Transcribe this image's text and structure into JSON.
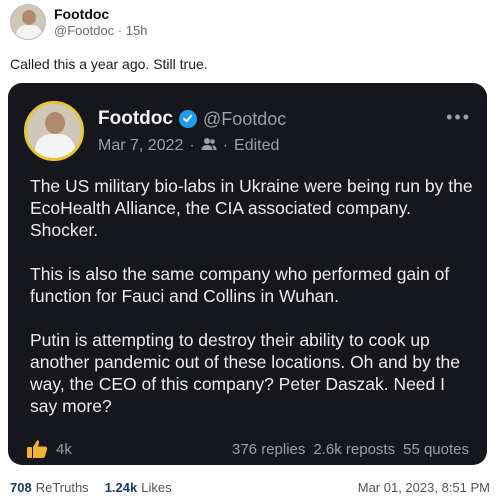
{
  "post": {
    "author_name": "Footdoc",
    "author_handle": "@Footdoc",
    "age": "15h",
    "text": "Called this a year ago. Still true."
  },
  "quoted": {
    "name": "Footdoc",
    "handle": "@Footdoc",
    "date": "Mar 7, 2022",
    "edited": "Edited",
    "paragraphs": [
      "The US military bio-labs in Ukraine were being run by the EcoHealth Alliance, the CIA associated company. Shocker.",
      "This is also the same company who performed gain of function for Fauci and Collins in Wuhan.",
      "Putin is attempting to destroy their ability to cook up another pandemic out of these locations. Oh and by the way, the CEO of this company? Peter Daszak. Need I say more?"
    ],
    "likes": "4k",
    "replies": "376 replies",
    "reposts": "2.6k reposts",
    "quotes": "55 quotes"
  },
  "stats": {
    "retruths_count": "708",
    "retruths_label": "ReTruths",
    "likes_count": "1.24k",
    "likes_label": "Likes",
    "timestamp": "Mar 01, 2023, 8:51 PM"
  },
  "colors": {
    "embed_bg": "#15171c",
    "verified_blue": "#1d9bf0",
    "avatar_ring": "#e7c534",
    "like_yellow": "#f2b233"
  },
  "icons": {
    "verified": "verified-check-icon",
    "audience": "people-icon",
    "more": "more-horizontal-icon",
    "like": "thumbs-up-icon"
  }
}
